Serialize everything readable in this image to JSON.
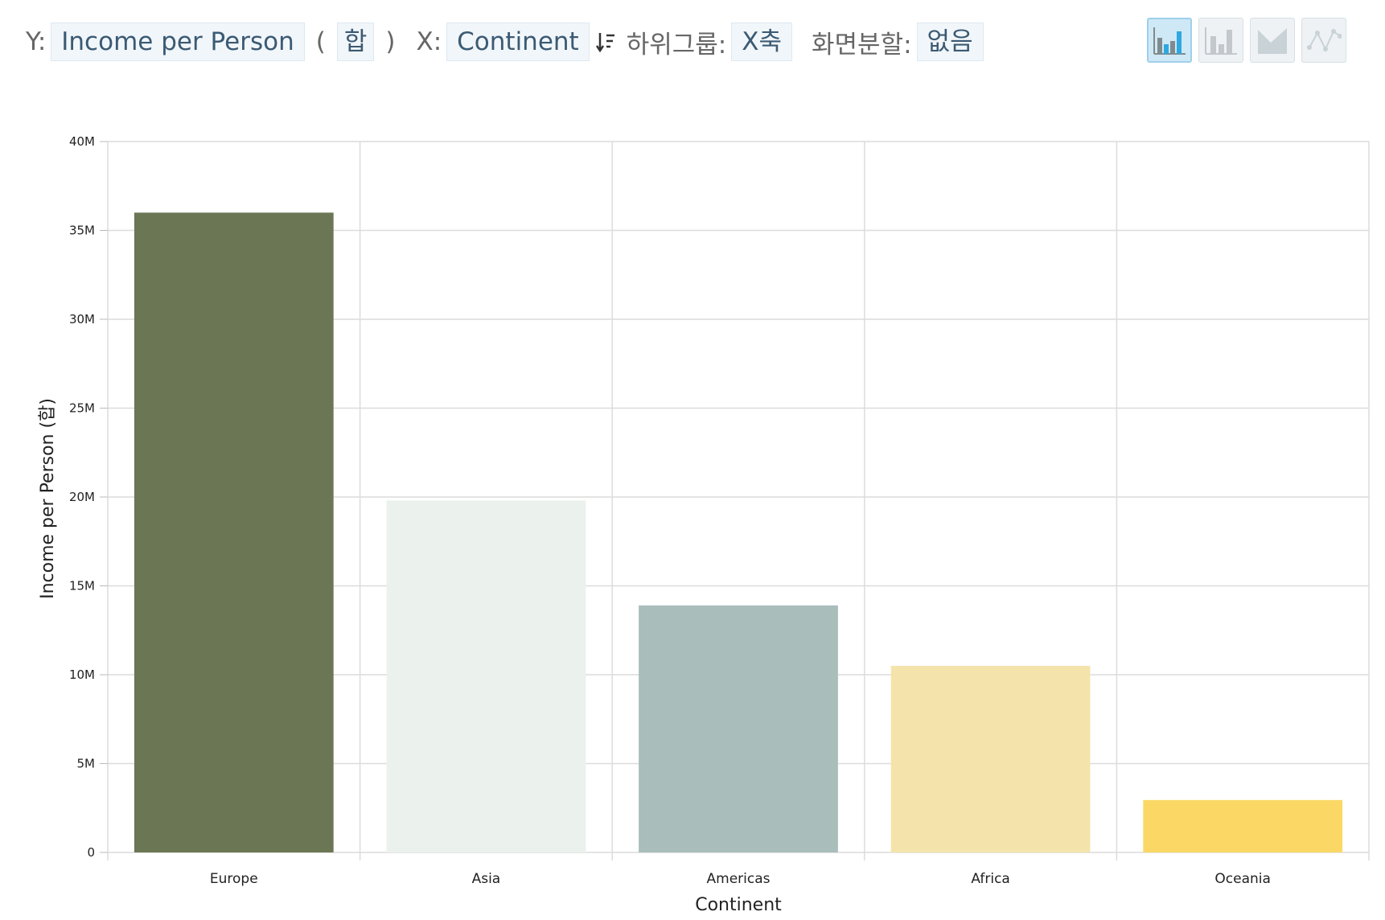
{
  "toolbar": {
    "y_label": "Y:",
    "y_value": "Income per Person",
    "paren_open": "(",
    "aggregation": "합",
    "paren_close": ")",
    "x_label": "X:",
    "x_value": "Continent",
    "subgroup_label": "하위그룹:",
    "subgroup_value": "X축",
    "split_label": "화면분할:",
    "split_value": "없음"
  },
  "chart_types": [
    "bar-chart-colored-icon",
    "bar-chart-icon",
    "area-chart-icon",
    "line-chart-icon"
  ],
  "chart_data": {
    "type": "bar",
    "categories": [
      "Europe",
      "Asia",
      "Americas",
      "Africa",
      "Oceania"
    ],
    "values": [
      36000000,
      19800000,
      13900000,
      10500000,
      2950000
    ],
    "colors": [
      "#6b7654",
      "#ebf1ec",
      "#a9bdbb",
      "#f4e4ab",
      "#fbd866"
    ],
    "ylim": [
      0,
      40000000
    ],
    "yticks": [
      0,
      5000000,
      10000000,
      15000000,
      20000000,
      25000000,
      30000000,
      35000000,
      40000000
    ],
    "ytick_labels": [
      "0",
      "5M",
      "10M",
      "15M",
      "20M",
      "25M",
      "30M",
      "35M",
      "40M"
    ],
    "xlabel": "Continent",
    "ylabel": "Income per Person (합)",
    "grid": true
  }
}
